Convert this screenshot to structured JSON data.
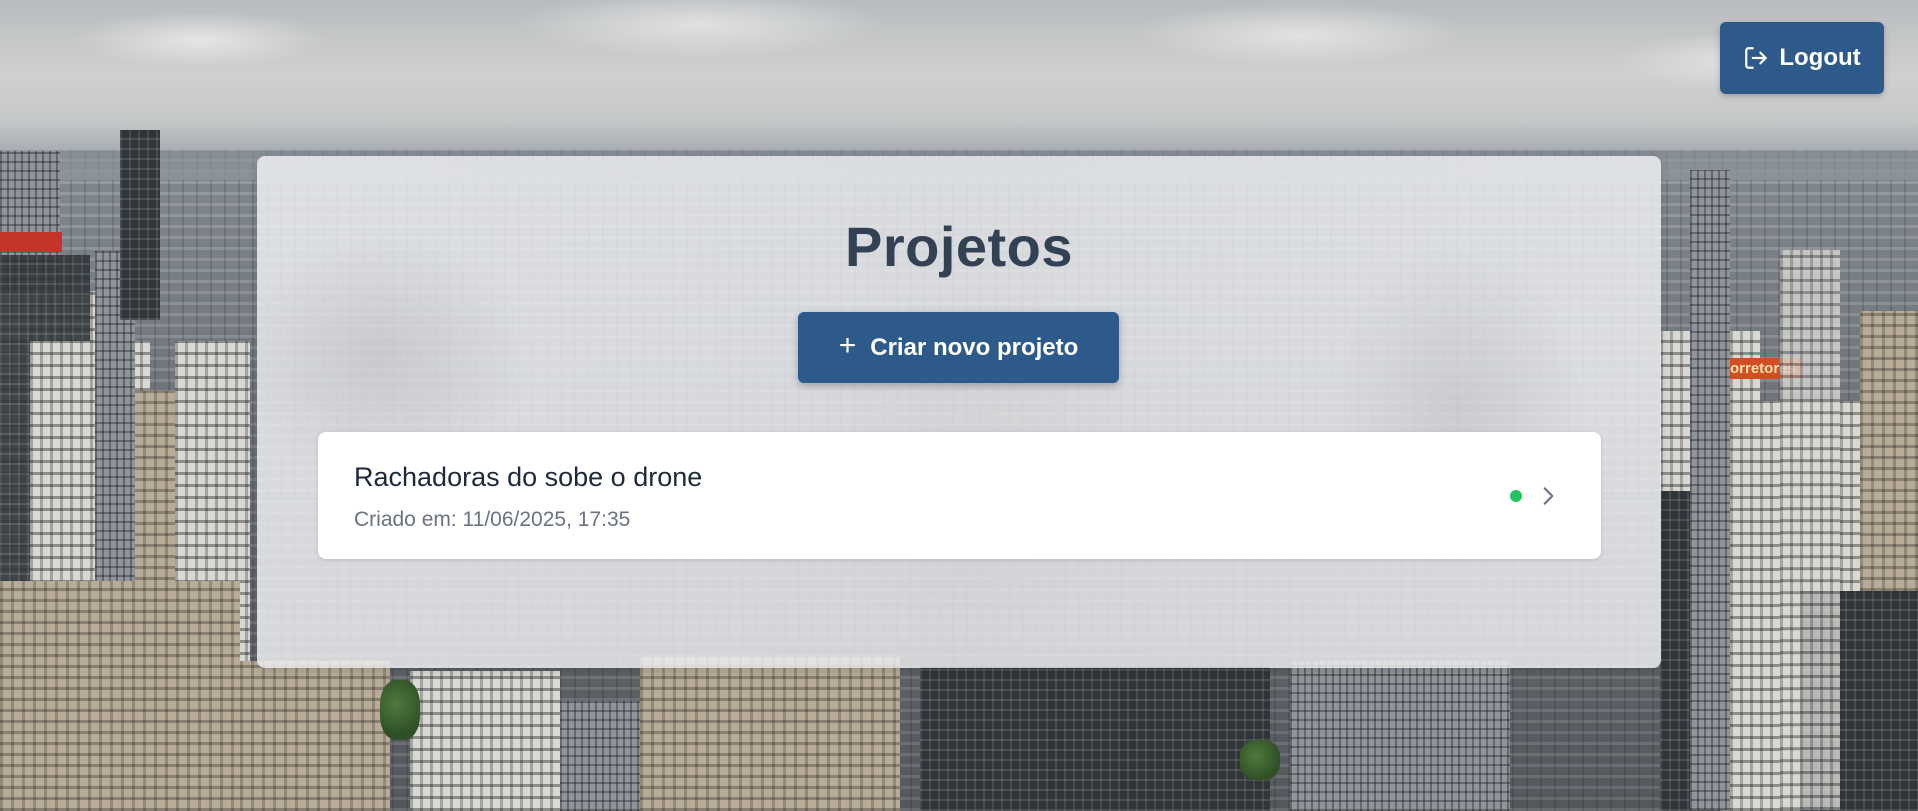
{
  "header": {
    "logout_label": "Logout",
    "logout_icon": "logout-icon"
  },
  "main": {
    "title": "Projetos",
    "create_button_label": "Criar novo projeto",
    "create_button_icon": "plus-icon",
    "projects": [
      {
        "name": "Rachadoras do sobe o drone",
        "created": "Criado em: 11/06/2025, 17:35",
        "status_color": "#22c55e",
        "status": "active"
      }
    ]
  },
  "colors": {
    "primary": "#2d5a8a",
    "title": "#334155",
    "status_active": "#22c55e"
  }
}
